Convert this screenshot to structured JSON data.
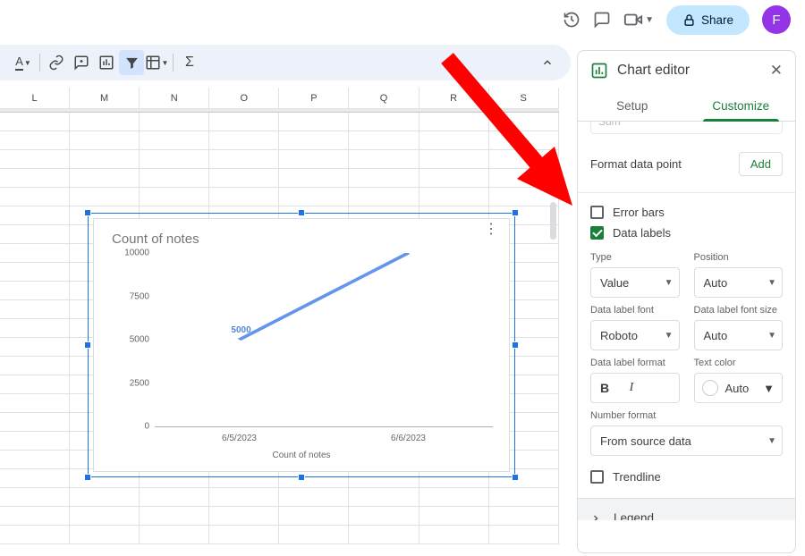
{
  "header": {
    "share_label": "Share",
    "avatar_initial": "F"
  },
  "sheet": {
    "columns": [
      "L",
      "M",
      "N",
      "O",
      "P",
      "Q",
      "R",
      "S"
    ]
  },
  "sidebar": {
    "title": "Chart editor",
    "tabs": {
      "setup": "Setup",
      "customize": "Customize"
    },
    "truncated_dropdown": "Sum",
    "format_data_point": "Format data point",
    "add": "Add",
    "error_bars": "Error bars",
    "data_labels": "Data labels",
    "type_label": "Type",
    "type_value": "Value",
    "position_label": "Position",
    "position_value": "Auto",
    "font_label": "Data label font",
    "font_value": "Roboto",
    "fontsize_label": "Data label font size",
    "fontsize_value": "Auto",
    "format_label": "Data label format",
    "textcolor_label": "Text color",
    "textcolor_value": "Auto",
    "number_format_label": "Number format",
    "number_format_value": "From source data",
    "trendline": "Trendline",
    "legend": "Legend"
  },
  "chart": {
    "title": "Count of notes",
    "x_axis_title": "Count of notes",
    "y_ticks": [
      "0",
      "2500",
      "5000",
      "7500",
      "10000"
    ],
    "x_ticks": [
      "6/5/2023",
      "6/6/2023"
    ],
    "data_label": "5000"
  },
  "chart_data": {
    "type": "line",
    "title": "Count of notes",
    "xlabel": "Count of notes",
    "ylabel": "",
    "ylim": [
      0,
      10000
    ],
    "categories": [
      "6/5/2023",
      "6/6/2023"
    ],
    "series": [
      {
        "name": "Count of notes",
        "values": [
          5000,
          10000
        ]
      }
    ]
  }
}
